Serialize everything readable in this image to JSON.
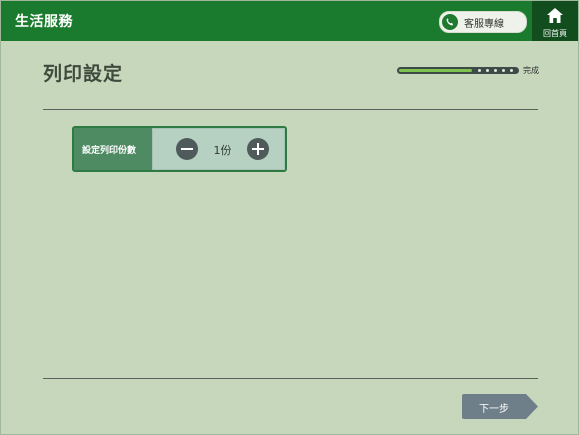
{
  "header": {
    "app_title": "生活服務",
    "hotline_label": "客服專線",
    "hotline_icon": "phone-icon",
    "home_label": "回首頁",
    "home_icon": "home-icon"
  },
  "page": {
    "title": "列印設定"
  },
  "progress": {
    "label": "完成",
    "filled_fraction": 0.62,
    "remaining_steps": 5
  },
  "setting": {
    "label": "設定列印份數",
    "minus_icon": "minus-icon",
    "plus_icon": "plus-icon",
    "value": "1份"
  },
  "footer": {
    "next_label": "下一步"
  },
  "colors": {
    "header_green": "#1a7a2d",
    "home_dark_green": "#124d1d",
    "page_background": "#c6d7bc",
    "progress_fill": "#7fc250",
    "button_gray": "#6e7f8a"
  }
}
